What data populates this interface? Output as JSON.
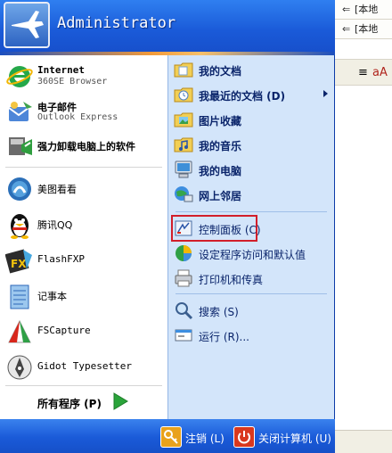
{
  "background_window": {
    "address_rows": [
      "[本地",
      "[本地"
    ],
    "toolbar_glyphs": [
      "≡",
      "aA"
    ]
  },
  "header": {
    "username": "Administrator"
  },
  "left": {
    "pinned": [
      {
        "title": "Internet",
        "subtitle": "360SE Browser",
        "icon": "ie-icon"
      },
      {
        "title": "电子邮件",
        "subtitle": "Outlook Express",
        "icon": "outlook-icon"
      }
    ],
    "recent": [
      {
        "label": "强力卸载电脑上的软件",
        "icon": "uninstaller-icon",
        "bold": true
      },
      {
        "label": "美图看看",
        "icon": "meitu-icon"
      },
      {
        "label": "腾讯QQ",
        "icon": "qq-penguin-icon"
      },
      {
        "label": "FlashFXP",
        "icon": "flashfxp-icon"
      },
      {
        "label": "记事本",
        "icon": "notepad-icon"
      },
      {
        "label": "FSCapture",
        "icon": "fscapture-icon"
      },
      {
        "label": "Gidot Typesetter",
        "icon": "typesetter-icon"
      }
    ],
    "all_programs": "所有程序 (P)"
  },
  "right": {
    "group1": [
      {
        "label": "我的文档",
        "icon": "my-documents-icon"
      },
      {
        "label": "我最近的文档 (D)",
        "icon": "recent-documents-icon",
        "submenu": true
      },
      {
        "label": "图片收藏",
        "icon": "my-pictures-icon"
      },
      {
        "label": "我的音乐",
        "icon": "my-music-icon"
      },
      {
        "label": "我的电脑",
        "icon": "my-computer-icon"
      },
      {
        "label": "网上邻居",
        "icon": "network-places-icon"
      }
    ],
    "group2": [
      {
        "label": "控制面板 (C)",
        "icon": "control-panel-icon",
        "highlighted": true
      },
      {
        "label": "设定程序访问和默认值",
        "icon": "program-defaults-icon"
      },
      {
        "label": "打印机和传真",
        "icon": "printer-icon"
      }
    ],
    "group3": [
      {
        "label": "搜索 (S)",
        "icon": "search-icon"
      },
      {
        "label": "运行 (R)...",
        "icon": "run-icon"
      }
    ]
  },
  "footer": {
    "logoff": "注销 (L)",
    "shutdown": "关闭计算机 (U)"
  },
  "colors": {
    "menu_blue": "#1f5fd6",
    "right_pane": "#d3e5fa",
    "highlight_border": "#d21e2a"
  }
}
